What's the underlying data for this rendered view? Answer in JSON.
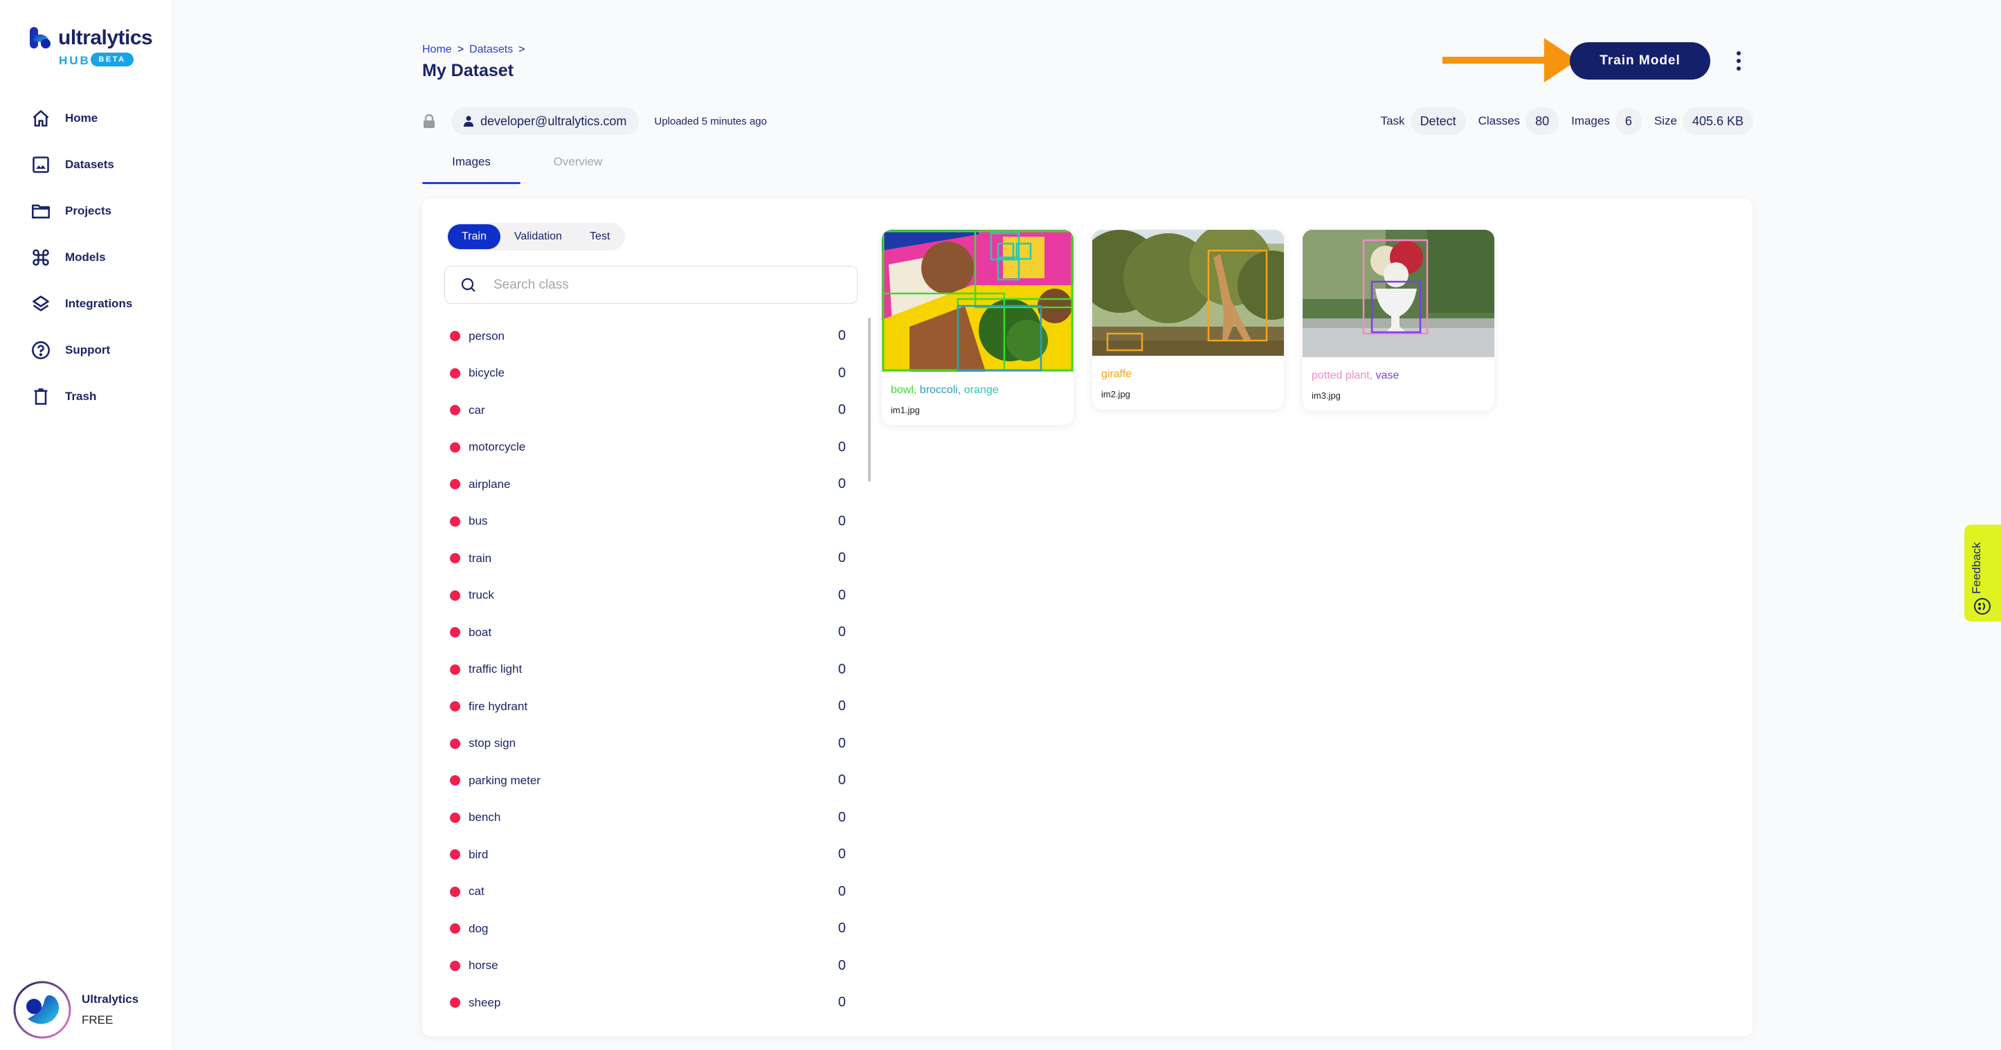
{
  "brand": {
    "name": "ultralytics",
    "product": "HUB",
    "badge": "BETA"
  },
  "sidebar": {
    "items": [
      {
        "label": "Home",
        "icon": "home-icon"
      },
      {
        "label": "Datasets",
        "icon": "image-icon"
      },
      {
        "label": "Projects",
        "icon": "folder-icon"
      },
      {
        "label": "Models",
        "icon": "command-icon"
      },
      {
        "label": "Integrations",
        "icon": "layers-icon"
      },
      {
        "label": "Support",
        "icon": "help-circle-icon"
      },
      {
        "label": "Trash",
        "icon": "trash-icon"
      }
    ],
    "user": {
      "name": "Ultralytics",
      "plan": "FREE"
    }
  },
  "header": {
    "breadcrumb": [
      "Home",
      "Datasets"
    ],
    "breadcrumb_sep": ">",
    "title": "My Dataset",
    "train_button": "Train Model",
    "owner": "developer@ultralytics.com",
    "uploaded": "Uploaded 5 minutes ago",
    "stats": [
      {
        "label": "Task",
        "value": "Detect"
      },
      {
        "label": "Classes",
        "value": "80"
      },
      {
        "label": "Images",
        "value": "6"
      },
      {
        "label": "Size",
        "value": "405.6 KB"
      }
    ]
  },
  "tabs": [
    {
      "label": "Images",
      "active": true
    },
    {
      "label": "Overview",
      "active": false
    }
  ],
  "panel": {
    "splits": [
      {
        "label": "Train",
        "active": true
      },
      {
        "label": "Validation",
        "active": false
      },
      {
        "label": "Test",
        "active": false
      }
    ],
    "search_placeholder": "Search class",
    "search_value": "",
    "classes": [
      {
        "name": "person",
        "count": "0"
      },
      {
        "name": "bicycle",
        "count": "0"
      },
      {
        "name": "car",
        "count": "0"
      },
      {
        "name": "motorcycle",
        "count": "0"
      },
      {
        "name": "airplane",
        "count": "0"
      },
      {
        "name": "bus",
        "count": "0"
      },
      {
        "name": "train",
        "count": "0"
      },
      {
        "name": "truck",
        "count": "0"
      },
      {
        "name": "boat",
        "count": "0"
      },
      {
        "name": "traffic light",
        "count": "0"
      },
      {
        "name": "fire hydrant",
        "count": "0"
      },
      {
        "name": "stop sign",
        "count": "0"
      },
      {
        "name": "parking meter",
        "count": "0"
      },
      {
        "name": "bench",
        "count": "0"
      },
      {
        "name": "bird",
        "count": "0"
      },
      {
        "name": "cat",
        "count": "0"
      },
      {
        "name": "dog",
        "count": "0"
      },
      {
        "name": "horse",
        "count": "0"
      },
      {
        "name": "sheep",
        "count": "0"
      }
    ],
    "class_dot_color": "#f0204f",
    "images": [
      {
        "file": "im1.jpg",
        "labels": [
          {
            "text": "bowl",
            "color": "#3ddc2a"
          },
          {
            "text": "broccoli",
            "color": "#2a9cc4"
          },
          {
            "text": "orange",
            "color": "#22c9b4"
          }
        ]
      },
      {
        "file": "im2.jpg",
        "labels": [
          {
            "text": "giraffe",
            "color": "#f2a51e"
          }
        ]
      },
      {
        "file": "im3.jpg",
        "labels": [
          {
            "text": "potted plant",
            "color": "#f28ac4"
          },
          {
            "text": "vase",
            "color": "#7b3df0"
          }
        ]
      }
    ]
  },
  "feedback": {
    "label": "Feedback"
  },
  "colors": {
    "primary": "#15206b",
    "accent": "#0f2fc9",
    "link": "#2b3fd6",
    "arrow": "#f7940f",
    "feedback_bg": "#def320",
    "hub_blue": "#1aa3ea"
  }
}
